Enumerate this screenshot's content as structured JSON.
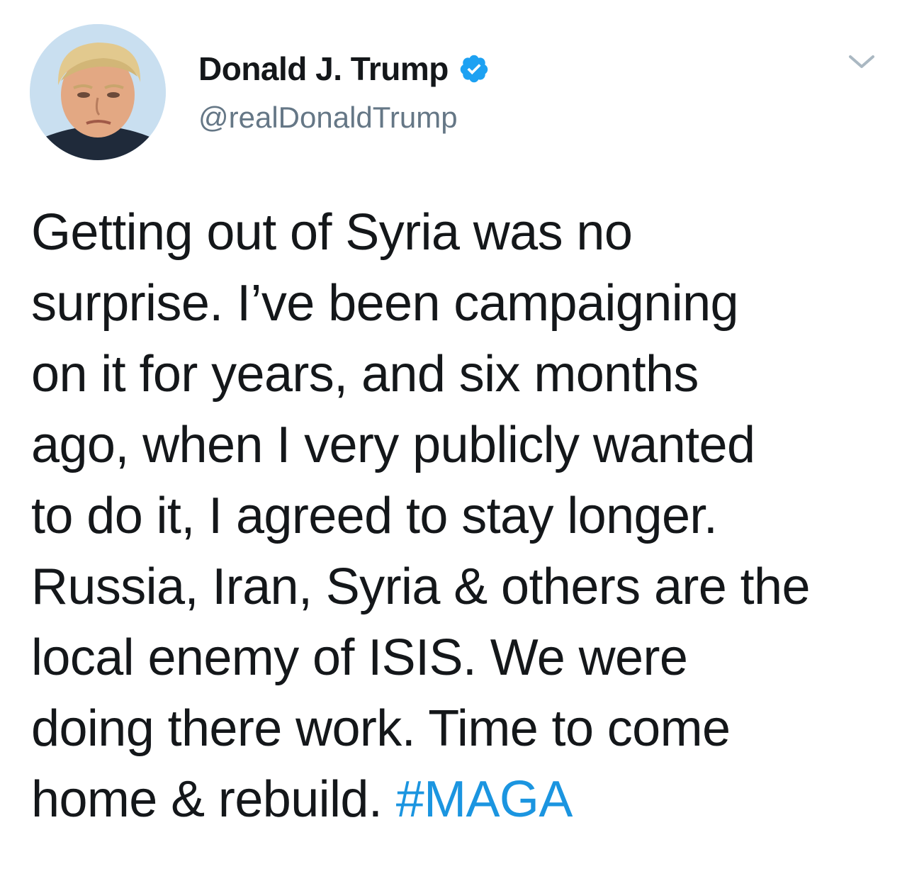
{
  "author": {
    "display_name": "Donald J. Trump",
    "handle": "@realDonaldTrump",
    "verified": true
  },
  "icons": {
    "verified": "verified-badge-icon",
    "menu": "chevron-down-icon"
  },
  "tweet": {
    "text": "Getting out of Syria was no\nsurprise. I’ve been campaigning\non it for years, and six months\nago, when I very publicly wanted\nto do it, I agreed to stay longer.\nRussia, Iran, Syria & others are the\nlocal enemy of ISIS. We were\ndoing there work. Time to come\nhome & rebuild. ",
    "hashtag": "#MAGA"
  },
  "colors": {
    "text": "#14171a",
    "secondary": "#657786",
    "link": "#1b95e0",
    "verified": "#1da1f2",
    "caret": "#aab8c2"
  }
}
